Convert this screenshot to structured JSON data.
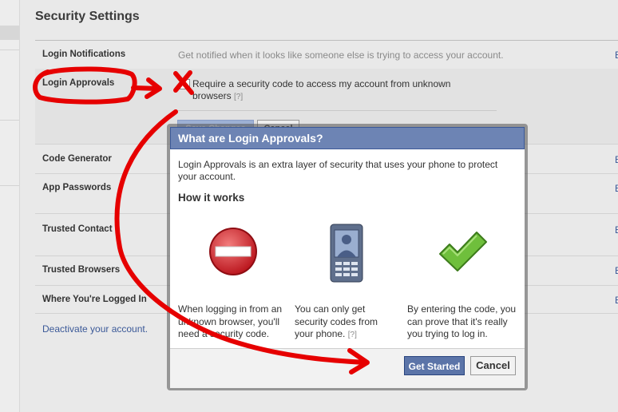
{
  "page": {
    "title": "Security Settings"
  },
  "settings": {
    "login_notifications": {
      "label": "Login Notifications",
      "desc": "Get notified when it looks like someone else is trying to access your account."
    },
    "login_approvals": {
      "label": "Login Approvals",
      "checkbox_label": "Require a security code to access my account from unknown browsers",
      "help": "[?]",
      "save_button": "Save Changes",
      "cancel_button": "Cancel"
    },
    "code_generator": {
      "label": "Code Generator"
    },
    "app_passwords": {
      "label": "App Passwords"
    },
    "trusted_contacts": {
      "label": "Trusted Contact"
    },
    "trusted_browsers": {
      "label": "Trusted Browsers"
    },
    "where_logged_in": {
      "label": "Where You're Logged In"
    },
    "edit_label": "E",
    "deactivate": "Deactivate your account."
  },
  "dialog": {
    "title": "What are Login Approvals?",
    "intro": "Login Approvals is an extra layer of security that uses your phone to protect your account.",
    "how_it_works": "How it works",
    "steps": [
      {
        "icon": "no-entry-icon",
        "text": "When logging in from an unknown browser, you'll need a security code."
      },
      {
        "icon": "phone-icon",
        "text": "You can only get security codes from your phone.",
        "help": "[?]"
      },
      {
        "icon": "checkmark-icon",
        "text": "By entering the code, you can prove that it's really you trying to log in."
      }
    ],
    "primary_button": "Get Started",
    "secondary_button": "Cancel"
  },
  "colors": {
    "header_blue": "#6d84b4",
    "link_blue": "#3b5998",
    "annotation_red": "#e60000"
  }
}
